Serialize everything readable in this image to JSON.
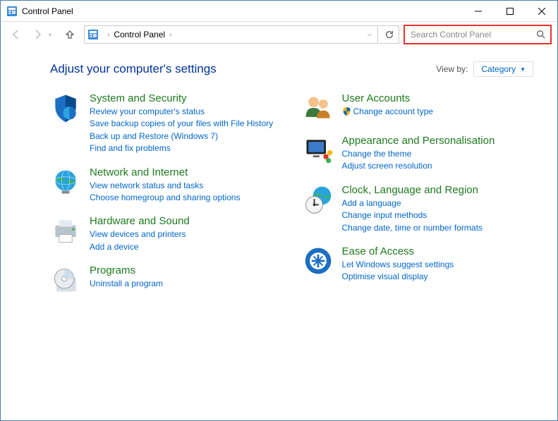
{
  "window": {
    "title": "Control Panel"
  },
  "address": {
    "location": "Control Panel"
  },
  "search": {
    "placeholder": "Search Control Panel"
  },
  "header": {
    "title": "Adjust your computer's settings",
    "viewby_label": "View by:",
    "viewby_value": "Category"
  },
  "left": [
    {
      "title": "System and Security",
      "links": [
        "Review your computer's status",
        "Save backup copies of your files with File History",
        "Back up and Restore (Windows 7)",
        "Find and fix problems"
      ]
    },
    {
      "title": "Network and Internet",
      "links": [
        "View network status and tasks",
        "Choose homegroup and sharing options"
      ]
    },
    {
      "title": "Hardware and Sound",
      "links": [
        "View devices and printers",
        "Add a device"
      ]
    },
    {
      "title": "Programs",
      "links": [
        "Uninstall a program"
      ]
    }
  ],
  "right": [
    {
      "title": "User Accounts",
      "links": [
        "Change account type"
      ],
      "shield_on": [
        0
      ]
    },
    {
      "title": "Appearance and Personalisation",
      "links": [
        "Change the theme",
        "Adjust screen resolution"
      ]
    },
    {
      "title": "Clock, Language and Region",
      "links": [
        "Add a language",
        "Change input methods",
        "Change date, time or number formats"
      ]
    },
    {
      "title": "Ease of Access",
      "links": [
        "Let Windows suggest settings",
        "Optimise visual display"
      ]
    }
  ]
}
